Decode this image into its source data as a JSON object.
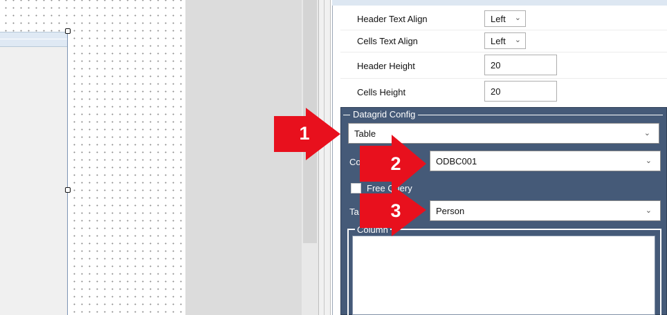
{
  "properties": {
    "header_text_align": {
      "label": "Header Text Align",
      "value": "Left"
    },
    "cells_text_align": {
      "label": "Cells Text Align",
      "value": "Left"
    },
    "header_height": {
      "label": "Header Height",
      "value": "20"
    },
    "cells_height": {
      "label": "Cells Height",
      "value": "20"
    }
  },
  "datagrid_config": {
    "title": "Datagrid Config",
    "source_type": "Table",
    "connection": {
      "label_visible": "Co",
      "value": "ODBC001"
    },
    "free_query": {
      "label": "Free Query",
      "checked": false
    },
    "table": {
      "label_visible": "Ta",
      "value": "Person"
    },
    "columns": {
      "title": "Column"
    }
  },
  "callouts": [
    {
      "number": "1",
      "color": "#e8101d"
    },
    {
      "number": "2",
      "color": "#e8101d"
    },
    {
      "number": "3",
      "color": "#e8101d"
    }
  ],
  "colors": {
    "config_panel": "#455a78",
    "callout": "#e8101d"
  },
  "icons": {
    "dropdown": "chevron-down-icon",
    "selection_handle": "resize-handle-icon"
  }
}
